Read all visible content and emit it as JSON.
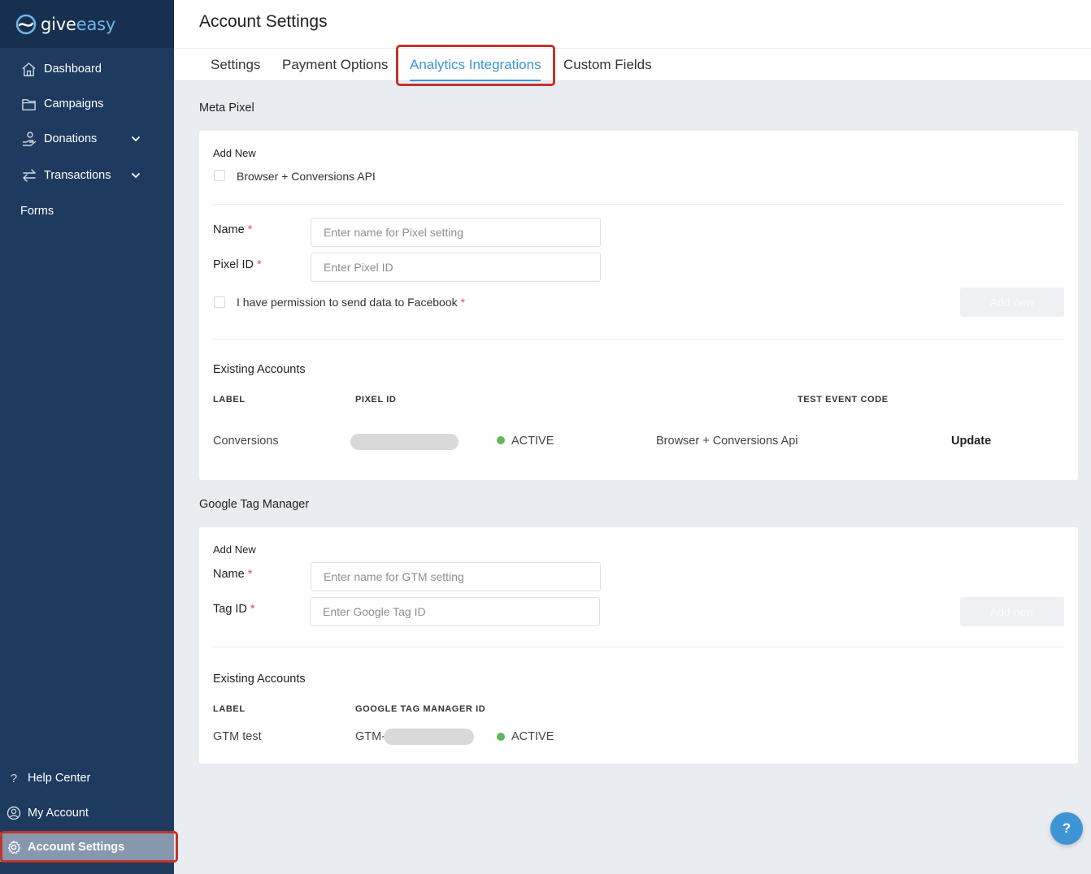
{
  "app": {
    "logo_give": "give",
    "logo_easy": "easy"
  },
  "sidebar": {
    "items": [
      {
        "label": "Dashboard",
        "icon": "home-icon"
      },
      {
        "label": "Campaigns",
        "icon": "folder-icon"
      },
      {
        "label": "Donations",
        "icon": "donation-hand-icon",
        "expandable": true
      },
      {
        "label": "Transactions",
        "icon": "transfer-arrows-icon",
        "expandable": true
      },
      {
        "label": "Forms"
      }
    ],
    "bottom_items": [
      {
        "label": "Help Center",
        "icon": "question-icon"
      },
      {
        "label": "My Account",
        "icon": "user-circle-icon"
      },
      {
        "label": "Account Settings",
        "icon": "gear-icon",
        "active": true
      }
    ]
  },
  "header": {
    "title": "Account Settings",
    "tabs": [
      {
        "label": "Settings"
      },
      {
        "label": "Payment Options"
      },
      {
        "label": "Analytics Integrations",
        "active": true
      },
      {
        "label": "Custom Fields"
      }
    ]
  },
  "meta_pixel": {
    "section_title": "Meta Pixel",
    "add_new_label": "Add New",
    "browser_checkbox_label": "Browser + Conversions API",
    "name_label": "Name",
    "name_placeholder": "Enter name for Pixel setting",
    "pixel_id_label": "Pixel ID",
    "pixel_id_placeholder": "Enter Pixel ID",
    "permission_label": "I have permission to send data to Facebook",
    "required_mark": "*",
    "add_button": "Add new",
    "existing_title": "Existing Accounts",
    "columns": {
      "label": "LABEL",
      "pixel_id": "PIXEL ID",
      "test_event_code": "TEST EVENT CODE"
    },
    "rows": [
      {
        "label": "Conversions",
        "status": "ACTIVE",
        "type": "Browser + Conversions Api",
        "action": "Update"
      }
    ]
  },
  "gtm": {
    "section_title": "Google Tag Manager",
    "add_new_label": "Add New",
    "name_label": "Name",
    "name_placeholder": "Enter name for GTM setting",
    "tag_id_label": "Tag ID",
    "tag_id_placeholder": "Enter Google Tag ID",
    "required_mark": "*",
    "add_button": "Add new",
    "existing_title": "Existing Accounts",
    "columns": {
      "label": "LABEL",
      "gtm_id": "GOOGLE TAG MANAGER ID"
    },
    "rows": [
      {
        "label": "GTM test",
        "id_prefix": "GTM-",
        "status": "ACTIVE"
      }
    ]
  },
  "help_button": "?",
  "colors": {
    "sidebar": "#1e3a5f",
    "accent": "#3d95d6",
    "active_status": "#5cb85c",
    "highlight": "#c0342b"
  }
}
